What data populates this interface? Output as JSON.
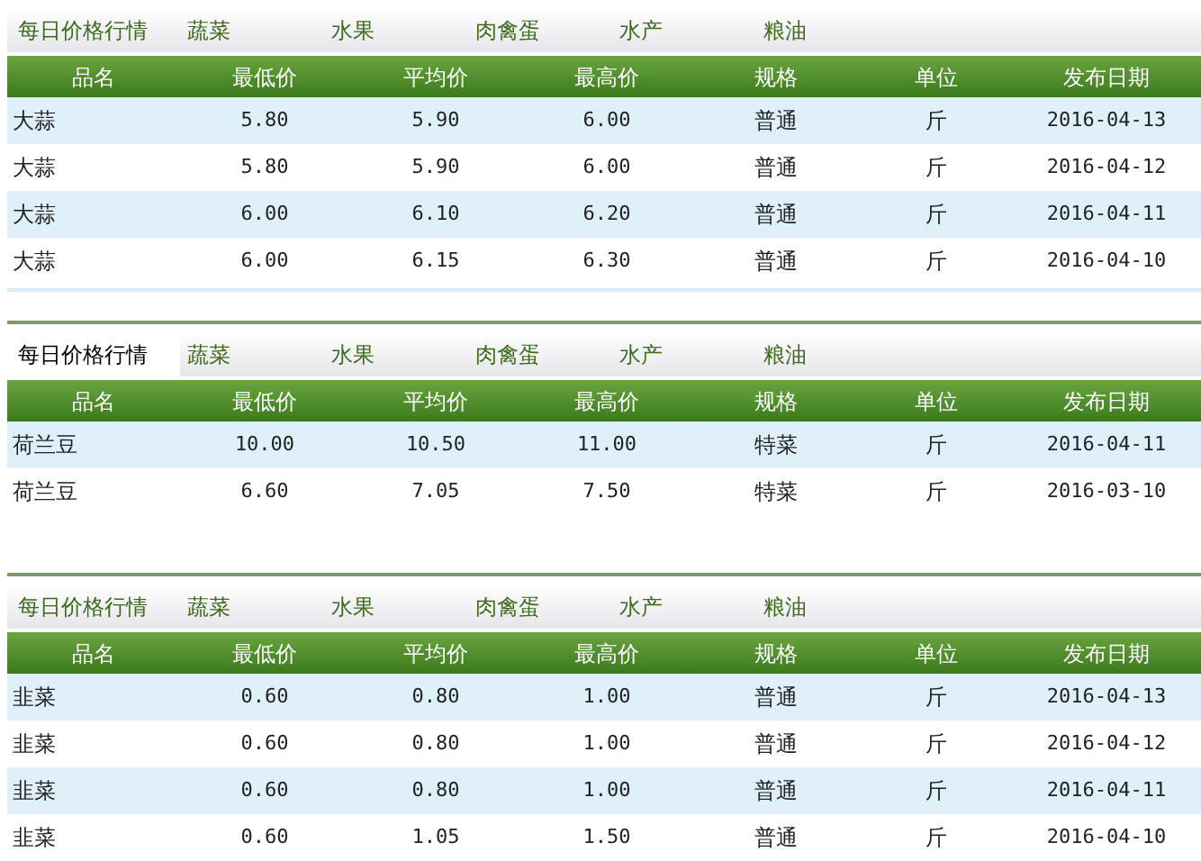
{
  "panels": [
    {
      "tabs": [
        {
          "label": "每日价格行情",
          "selected": false
        },
        {
          "label": "蔬菜",
          "selected": false
        },
        {
          "label": "水果",
          "selected": false
        },
        {
          "label": "肉禽蛋",
          "selected": false
        },
        {
          "label": "水产",
          "selected": false
        },
        {
          "label": "粮油",
          "selected": false
        }
      ],
      "columns": [
        "品名",
        "最低价",
        "平均价",
        "最高价",
        "规格",
        "单位",
        "发布日期"
      ],
      "rows": [
        [
          "大蒜",
          "5.80",
          "5.90",
          "6.00",
          "普通",
          "斤",
          "2016-04-13"
        ],
        [
          "大蒜",
          "5.80",
          "5.90",
          "6.00",
          "普通",
          "斤",
          "2016-04-12"
        ],
        [
          "大蒜",
          "6.00",
          "6.10",
          "6.20",
          "普通",
          "斤",
          "2016-04-11"
        ],
        [
          "大蒜",
          "6.00",
          "6.15",
          "6.30",
          "普通",
          "斤",
          "2016-04-10"
        ]
      ]
    },
    {
      "tabs": [
        {
          "label": "每日价格行情",
          "selected": true
        },
        {
          "label": "蔬菜",
          "selected": false
        },
        {
          "label": "水果",
          "selected": false
        },
        {
          "label": "肉禽蛋",
          "selected": false
        },
        {
          "label": "水产",
          "selected": false
        },
        {
          "label": "粮油",
          "selected": false
        }
      ],
      "columns": [
        "品名",
        "最低价",
        "平均价",
        "最高价",
        "规格",
        "单位",
        "发布日期"
      ],
      "rows": [
        [
          "荷兰豆",
          "10.00",
          "10.50",
          "11.00",
          "特菜",
          "斤",
          "2016-04-11"
        ],
        [
          "荷兰豆",
          "6.60",
          "7.05",
          "7.50",
          "特菜",
          "斤",
          "2016-03-10"
        ]
      ]
    },
    {
      "tabs": [
        {
          "label": "每日价格行情",
          "selected": false
        },
        {
          "label": "蔬菜",
          "selected": false
        },
        {
          "label": "水果",
          "selected": false
        },
        {
          "label": "肉禽蛋",
          "selected": false
        },
        {
          "label": "水产",
          "selected": false
        },
        {
          "label": "粮油",
          "selected": false
        }
      ],
      "columns": [
        "品名",
        "最低价",
        "平均价",
        "最高价",
        "规格",
        "单位",
        "发布日期"
      ],
      "rows": [
        [
          "韭菜",
          "0.60",
          "0.80",
          "1.00",
          "普通",
          "斤",
          "2016-04-13"
        ],
        [
          "韭菜",
          "0.60",
          "0.80",
          "1.00",
          "普通",
          "斤",
          "2016-04-12"
        ],
        [
          "韭菜",
          "0.60",
          "0.80",
          "1.00",
          "普通",
          "斤",
          "2016-04-11"
        ],
        [
          "韭菜",
          "0.60",
          "1.05",
          "1.50",
          "普通",
          "斤",
          "2016-04-10"
        ]
      ]
    }
  ]
}
